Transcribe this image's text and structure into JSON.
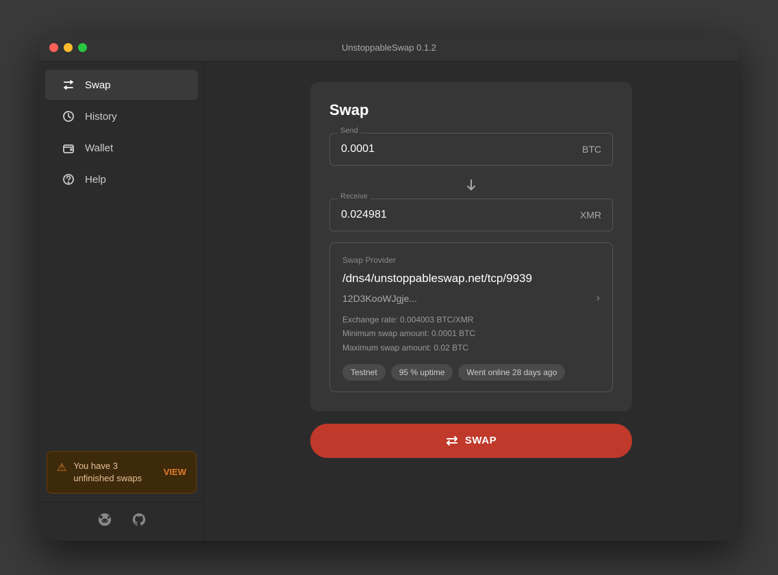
{
  "window": {
    "title": "UnstoppableSwap 0.1.2"
  },
  "sidebar": {
    "nav": [
      {
        "id": "swap",
        "label": "Swap",
        "icon": "⇄",
        "active": true
      },
      {
        "id": "history",
        "label": "History",
        "icon": "↺",
        "active": false
      },
      {
        "id": "wallet",
        "label": "Wallet",
        "icon": "▣",
        "active": false
      },
      {
        "id": "help",
        "label": "Help",
        "icon": "?",
        "active": false
      }
    ],
    "banner": {
      "icon": "⚠",
      "text": "You have 3 unfinished swaps",
      "view_label": "VIEW"
    },
    "footer": {
      "reddit_icon": "reddit",
      "github_icon": "github"
    }
  },
  "main": {
    "card_title": "Swap",
    "send_label": "Send",
    "send_value": "0.0001",
    "send_currency": "BTC",
    "receive_label": "Receive",
    "receive_value": "0.024981",
    "receive_currency": "XMR",
    "provider": {
      "label": "Swap Provider",
      "address": "/dns4/unstoppableswap.net/tcp/9939",
      "peer_id": "12D3KooWJgje...",
      "exchange_rate": "Exchange rate: 0.004003 BTC/XMR",
      "min_swap": "Minimum swap amount: 0.0001 BTC",
      "max_swap": "Maximum swap amount: 0.02 BTC",
      "badges": [
        "Testnet",
        "95 % uptime",
        "Went online 28 days ago"
      ]
    },
    "swap_button_label": "SWAP"
  }
}
